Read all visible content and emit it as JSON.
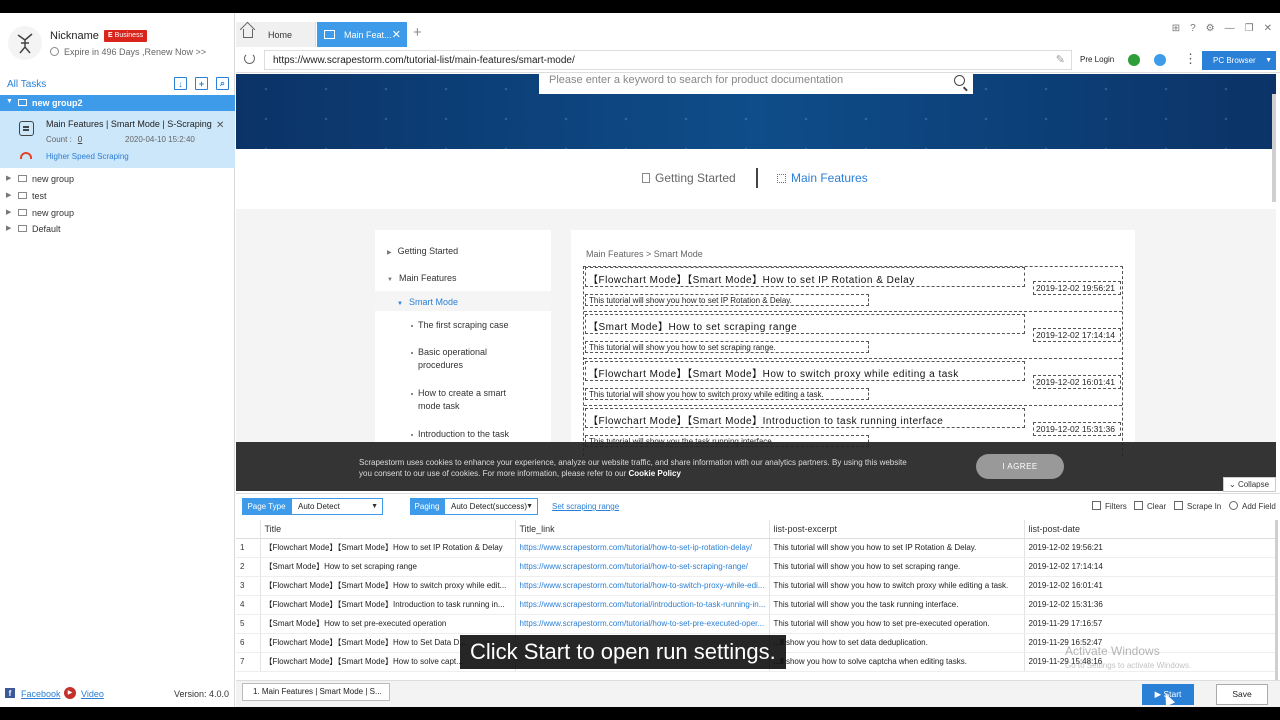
{
  "user": {
    "nickname": "Nickname",
    "badge_letter": "E",
    "badge_text": "Business",
    "expire_text": "Expire in 496 Days ,Renew Now >>"
  },
  "tasks_header": {
    "title": "All Tasks"
  },
  "active_group": {
    "name": "new group2"
  },
  "task_card": {
    "name": "Main Features | Smart Mode | S-Scraping",
    "count_label": "Count :",
    "count": "0",
    "date": "2020-04-10 15:2:40",
    "speed_label": "Higher Speed Scraping"
  },
  "groups": [
    "new group",
    "test",
    "new group",
    "Default"
  ],
  "footer": {
    "facebook": "Facebook",
    "video": "Video",
    "version": "Version: 4.0.0"
  },
  "tabs": {
    "home": "Home",
    "active": "Main Feat..."
  },
  "address": {
    "url": "https://www.scrapestorm.com/tutorial-list/main-features/smart-mode/",
    "pre_login": "Pre Login",
    "pc_browser": "PC Browser"
  },
  "page": {
    "search_placeholder": "Please enter a keyword to search for product documentation",
    "nav_getting_started": "Getting Started",
    "nav_main_features": "Main Features",
    "menu": {
      "getting_started": "Getting Started",
      "main_features": "Main Features",
      "smart_mode": "Smart Mode",
      "sub1": "The first scraping case",
      "sub2": "Basic operational procedures",
      "sub3": "How to create a smart mode task",
      "sub4": "Introduction to the task"
    },
    "breadcrumb": "Main Features > Smart Mode",
    "articles": [
      {
        "title": "【Flowchart Mode】【Smart Mode】How to set IP Rotation & Delay",
        "desc": "This tutorial will show you how to set IP Rotation & Delay.",
        "date": "2019-12-02 19:56:21"
      },
      {
        "title": "【Smart Mode】How to set scraping range",
        "desc": "This tutorial will show you how to set scraping range.",
        "date": "2019-12-02 17:14:14"
      },
      {
        "title": "【Flowchart Mode】【Smart Mode】How to switch proxy while editing a task",
        "desc": "This tutorial will show you how to switch proxy while editing a task.",
        "date": "2019-12-02 16:01:41"
      },
      {
        "title": "【Flowchart Mode】【Smart Mode】Introduction to task running interface",
        "desc": "This tutorial will show you the task running interface.",
        "date": "2019-12-02 15:31:36"
      }
    ]
  },
  "cookie": {
    "text": "Scrapestorm uses cookies to enhance your experience, analyze our website traffic, and share information with our analytics partners. By using this website you consent to our use of cookies. For more information, please refer to our ",
    "policy": "Cookie Policy",
    "agree": "I AGREE",
    "collapse": "Collapse"
  },
  "toolbar": {
    "page_type_label": "Page Type",
    "page_type_value": "Auto Detect",
    "paging_label": "Paging",
    "paging_value": "Auto Detect(success)",
    "set_range": "Set scraping range",
    "filters": "Filters",
    "clear": "Clear",
    "scrape_in": "Scrape In",
    "add_field": "Add Field"
  },
  "table": {
    "headers": [
      "",
      "Title",
      "Title_link",
      "list-post-excerpt",
      "list-post-date"
    ],
    "rows": [
      [
        "1",
        "【Flowchart Mode】【Smart Mode】How to set IP Rotation & Delay",
        "https://www.scrapestorm.com/tutorial/how-to-set-ip-rotation-delay/",
        "This tutorial will show you how to set IP Rotation & Delay.",
        "2019-12-02 19:56:21"
      ],
      [
        "2",
        "【Smart Mode】How to set scraping range",
        "https://www.scrapestorm.com/tutorial/how-to-set-scraping-range/",
        "This tutorial will show you how to set scraping range.",
        "2019-12-02 17:14:14"
      ],
      [
        "3",
        "【Flowchart Mode】【Smart Mode】How to switch proxy while edit...",
        "https://www.scrapestorm.com/tutorial/how-to-switch-proxy-while-edi...",
        "This tutorial will show you how to switch proxy while editing a task.",
        "2019-12-02 16:01:41"
      ],
      [
        "4",
        "【Flowchart Mode】【Smart Mode】Introduction to task running in...",
        "https://www.scrapestorm.com/tutorial/introduction-to-task-running-in...",
        "This tutorial will show you the task running interface.",
        "2019-12-02 15:31:36"
      ],
      [
        "5",
        "【Smart Mode】How to set pre-executed operation",
        "https://www.scrapestorm.com/tutorial/how-to-set-pre-executed-oper...",
        "This tutorial will show you how to set pre-executed operation.",
        "2019-11-29 17:16:57"
      ],
      [
        "6",
        "【Flowchart Mode】【Smart Mode】How to Set Data D...",
        "",
        "...ll show you how to set data deduplication.",
        "2019-11-29 16:52:47"
      ],
      [
        "7",
        "【Flowchart Mode】【Smart Mode】How to solve capt...",
        "",
        "...ll show you how to solve captcha when editing tasks.",
        "2019-11-29 15:48:16"
      ]
    ]
  },
  "bottom": {
    "task_tab": "1. Main Features | Smart Mode | S...",
    "start": "Start",
    "save": "Save"
  },
  "overlay": {
    "caption": "Click Start to open run settings.",
    "watermark": "Activate Windows",
    "watermark_sub": "Go to Settings to activate Windows."
  }
}
